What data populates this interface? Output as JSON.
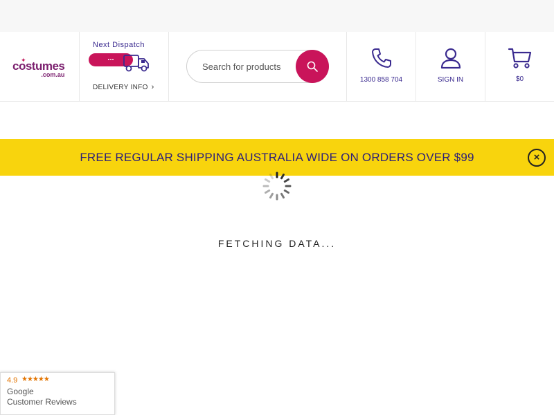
{
  "header": {
    "logo": {
      "main": "costumes",
      "sub": ".com.au"
    },
    "dispatch": {
      "title": "Next Dispatch",
      "status": "...",
      "delivery_label": "DELIVERY INFO",
      "chevron": "›"
    },
    "search": {
      "placeholder": "Search for products",
      "icon": "search-icon"
    },
    "phone": {
      "label": "1300 858 704",
      "icon": "phone-icon"
    },
    "signin": {
      "label": "SIGN IN",
      "icon": "user-icon"
    },
    "cart": {
      "label": "$0",
      "icon": "cart-icon"
    }
  },
  "banner": {
    "text": "FREE REGULAR SHIPPING AUSTRALIA WIDE ON ORDERS OVER $99",
    "close_icon": "close-icon",
    "close_glyph": "×"
  },
  "loading": {
    "text": "FETCHING DATA..."
  },
  "reviews": {
    "rating": "4.9",
    "stars": "★★★★★",
    "brand": "Google",
    "label": "Customer Reviews"
  },
  "colors": {
    "brand_purple": "#7b1f6e",
    "accent_pink": "#c9145a",
    "navy": "#3a2a8f",
    "banner_yellow": "#f8d40d"
  }
}
